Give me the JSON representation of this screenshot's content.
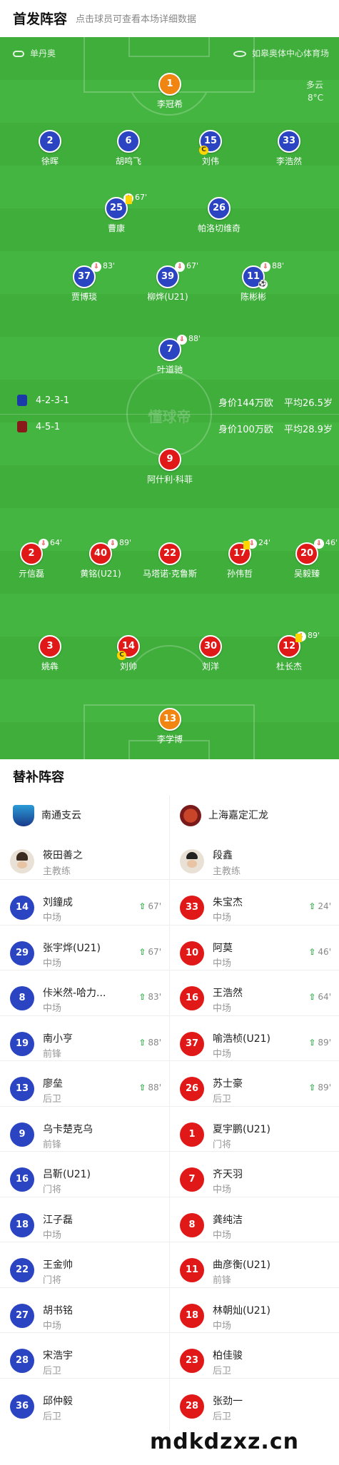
{
  "header": {
    "title": "首发阵容",
    "subtitle": "点击球员可查看本场详细数据"
  },
  "pitch_info": {
    "referee": "单丹奥",
    "venue": "如皋奥体中心体育场",
    "weather": "多云",
    "temp": "8°C",
    "watermark": "懂球帝"
  },
  "home": {
    "formation": "4-2-3-1",
    "value": "身价144万欧",
    "age": "平均26.5岁",
    "players": [
      {
        "no": "1",
        "name": "李冠希",
        "color": "orange"
      },
      {
        "no": "2",
        "name": "徐晖"
      },
      {
        "no": "6",
        "name": "胡鸣飞"
      },
      {
        "no": "15",
        "name": "刘伟",
        "captain": "C"
      },
      {
        "no": "33",
        "name": "李浩然"
      },
      {
        "no": "25",
        "name": "曹康",
        "sub": "67'"
      },
      {
        "no": "26",
        "name": "帕洛切维奇"
      },
      {
        "no": "37",
        "name": "贾博琰",
        "sub": "83'"
      },
      {
        "no": "39",
        "name": "柳烨(U21)",
        "sub": "67'"
      },
      {
        "no": "11",
        "name": "陈彬彬",
        "sub": "88'"
      },
      {
        "no": "7",
        "name": "叶道驰",
        "sub": "88'"
      }
    ]
  },
  "away": {
    "formation": "4-5-1",
    "value": "身价100万欧",
    "age": "平均28.9岁",
    "players": [
      {
        "no": "9",
        "name": "阿什利·科菲"
      },
      {
        "no": "2",
        "name": "亓信磊",
        "sub": "64'"
      },
      {
        "no": "40",
        "name": "黄铭(U21)",
        "sub": "89'"
      },
      {
        "no": "22",
        "name": "马塔诺·克鲁斯"
      },
      {
        "no": "17",
        "name": "孙伟哲",
        "sub": "24'"
      },
      {
        "no": "20",
        "name": "吴毅臻",
        "sub": "46'"
      },
      {
        "no": "3",
        "name": "姚犇"
      },
      {
        "no": "14",
        "name": "刘帅",
        "captain": "C"
      },
      {
        "no": "30",
        "name": "刘洋"
      },
      {
        "no": "12",
        "name": "杜长杰",
        "sub": "89'"
      },
      {
        "no": "13",
        "name": "李学博",
        "color": "orange"
      }
    ]
  },
  "bench": {
    "title": "替补阵容",
    "home_team": "南通支云",
    "away_team": "上海嘉定汇龙",
    "home_coach": {
      "name": "筱田善之",
      "role": "主教练"
    },
    "away_coach": {
      "name": "段鑫",
      "role": "主教练"
    },
    "home_subs": [
      {
        "no": "14",
        "name": "刘鐘成",
        "pos": "中场",
        "in": "67'"
      },
      {
        "no": "29",
        "name": "张宇烨(U21)",
        "pos": "中场",
        "in": "67'"
      },
      {
        "no": "8",
        "name": "佧米然-哈力...",
        "pos": "中场",
        "in": "83'"
      },
      {
        "no": "19",
        "name": "南小亨",
        "pos": "前锋",
        "in": "88'"
      },
      {
        "no": "13",
        "name": "廖垒",
        "pos": "后卫",
        "in": "88'"
      },
      {
        "no": "9",
        "name": "乌卡楚克乌",
        "pos": "前锋",
        "in": ""
      },
      {
        "no": "16",
        "name": "吕靳(U21)",
        "pos": "门将",
        "in": ""
      },
      {
        "no": "18",
        "name": "江子磊",
        "pos": "中场",
        "in": ""
      },
      {
        "no": "22",
        "name": "王金帅",
        "pos": "门将",
        "in": ""
      },
      {
        "no": "27",
        "name": "胡书铭",
        "pos": "中场",
        "in": ""
      },
      {
        "no": "28",
        "name": "宋浩宇",
        "pos": "后卫",
        "in": ""
      },
      {
        "no": "36",
        "name": "邱仲毅",
        "pos": "后卫",
        "in": ""
      }
    ],
    "away_subs": [
      {
        "no": "33",
        "name": "朱宝杰",
        "pos": "中场",
        "in": "24'"
      },
      {
        "no": "10",
        "name": "阿莫",
        "pos": "中场",
        "in": "46'"
      },
      {
        "no": "16",
        "name": "王浩然",
        "pos": "中场",
        "in": "64'"
      },
      {
        "no": "37",
        "name": "喻浩桢(U21)",
        "pos": "中场",
        "in": "89'"
      },
      {
        "no": "26",
        "name": "苏士豪",
        "pos": "后卫",
        "in": "89'"
      },
      {
        "no": "1",
        "name": "夏宇鹏(U21)",
        "pos": "门将",
        "in": ""
      },
      {
        "no": "7",
        "name": "齐天羽",
        "pos": "中场",
        "in": ""
      },
      {
        "no": "8",
        "name": "龚纯洁",
        "pos": "中场",
        "in": ""
      },
      {
        "no": "11",
        "name": "曲彦衡(U21)",
        "pos": "前锋",
        "in": ""
      },
      {
        "no": "18",
        "name": "林朝灿(U21)",
        "pos": "中场",
        "in": ""
      },
      {
        "no": "23",
        "name": "柏佳骏",
        "pos": "后卫",
        "in": ""
      },
      {
        "no": "28",
        "name": "张劲一",
        "pos": "后卫",
        "in": ""
      }
    ]
  },
  "footer": {
    "watermark": "mdkdzxz.cn"
  },
  "colors": {
    "pitch": "#3fae3b",
    "home": "#2a44c2",
    "away": "#e01818",
    "keeper": "#f08512",
    "sub_in": "#2db34a"
  }
}
